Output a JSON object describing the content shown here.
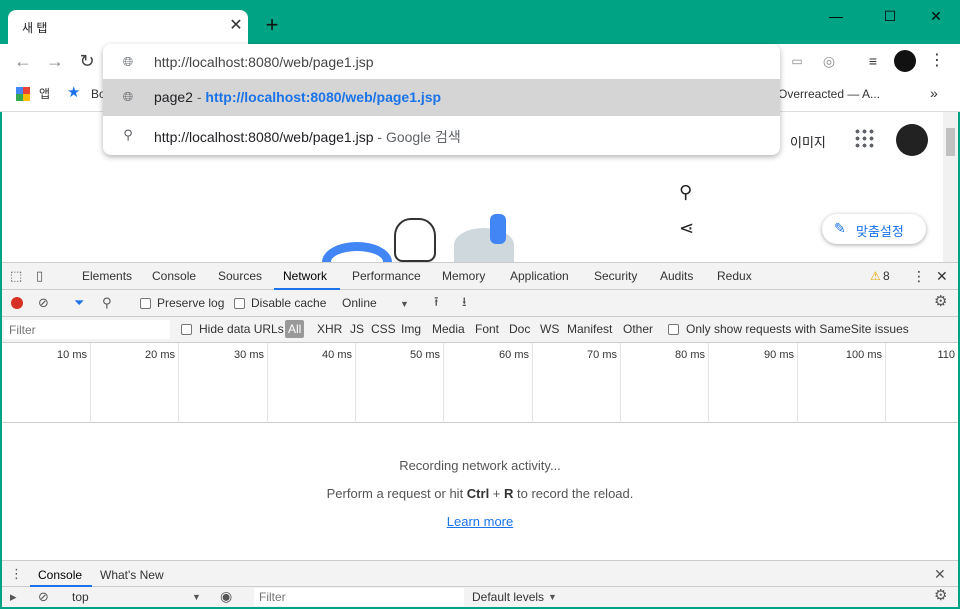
{
  "tab": {
    "title": "새 탭",
    "close": "✕",
    "new": "+"
  },
  "window": {
    "minimize": "—",
    "maximize": "☐",
    "close": "✕"
  },
  "omnibox": {
    "input": "http://localhost:8080/web/page1.jsp",
    "suggestions": [
      {
        "title": "page2",
        "sep": " - ",
        "url": "http://localhost:8080/web/page1.jsp"
      },
      {
        "title": "http://localhost:8080/web/page1.jsp",
        "sep": " - ",
        "url": "Google 검색"
      }
    ]
  },
  "bookmarks": {
    "apps": "앱",
    "bookmark1": "Bo",
    "right_item": "Overreacted — A...",
    "more": "»"
  },
  "page": {
    "images_link": "이미지",
    "customize_button": "맞춤설정"
  },
  "devtools": {
    "tabs": [
      "Elements",
      "Console",
      "Sources",
      "Network",
      "Performance",
      "Memory",
      "Application",
      "Security",
      "Audits",
      "Redux"
    ],
    "warning_count": "8",
    "toolbar": {
      "preserve_log": "Preserve log",
      "disable_cache": "Disable cache",
      "throttle": "Online"
    },
    "filter": {
      "placeholder": "Filter",
      "hide_data_urls": "Hide data URLs",
      "types": [
        "All",
        "XHR",
        "JS",
        "CSS",
        "Img",
        "Media",
        "Font",
        "Doc",
        "WS",
        "Manifest",
        "Other"
      ],
      "samesite": "Only show requests with SameSite issues"
    },
    "timeline_ticks": [
      "10 ms",
      "20 ms",
      "30 ms",
      "40 ms",
      "50 ms",
      "60 ms",
      "70 ms",
      "80 ms",
      "90 ms",
      "100 ms",
      "110"
    ],
    "empty": {
      "line1": "Recording network activity...",
      "line2_pre": "Perform a request or hit ",
      "line2_ctrl": "Ctrl",
      "line2_plus": " + ",
      "line2_r": "R",
      "line2_post": " to record the reload.",
      "learn_more": "Learn more"
    },
    "drawer": {
      "tabs": [
        "Console",
        "What's New"
      ],
      "context": "top",
      "filter_placeholder": "Filter",
      "levels": "Default levels"
    }
  },
  "colors": {
    "accent": "#00a383",
    "link": "#1a73e8",
    "record": "#d93025"
  }
}
